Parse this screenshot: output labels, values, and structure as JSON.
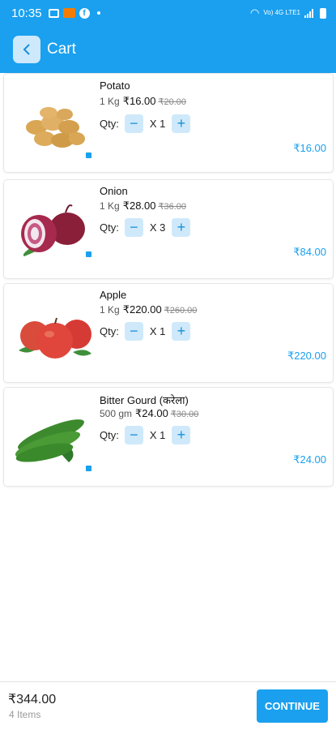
{
  "status_bar": {
    "time": "10:35",
    "network_text": "Vo) 4G LTE1"
  },
  "app_bar": {
    "title": "Cart",
    "back_icon": "chevron-left-icon"
  },
  "cart": {
    "items": [
      {
        "name": "Potato",
        "unit": "1 Kg",
        "price": "₹16.00",
        "mrp": "₹20.00",
        "qty_label": "Qty:",
        "qty": "X 1",
        "total": "₹16.00"
      },
      {
        "name": "Onion",
        "unit": "1 Kg",
        "price": "₹28.00",
        "mrp": "₹36.00",
        "qty_label": "Qty:",
        "qty": "X 3",
        "total": "₹84.00"
      },
      {
        "name": "Apple",
        "unit": "1 Kg",
        "price": "₹220.00",
        "mrp": "₹260.00",
        "qty_label": "Qty:",
        "qty": "X 1",
        "total": "₹220.00"
      },
      {
        "name": "Bitter Gourd  (करेला)",
        "unit": "500 gm",
        "price": "₹24.00",
        "mrp": "₹30.00",
        "qty_label": "Qty:",
        "qty": "X 1",
        "total": "₹24.00"
      }
    ],
    "minus_symbol": "−",
    "plus_symbol": "+"
  },
  "footer": {
    "total": "₹344.00",
    "count": "4 Items",
    "continue_label": "CONTINUE"
  },
  "colors": {
    "primary": "#1aa0ef",
    "button_tint": "#cfe9fb"
  }
}
